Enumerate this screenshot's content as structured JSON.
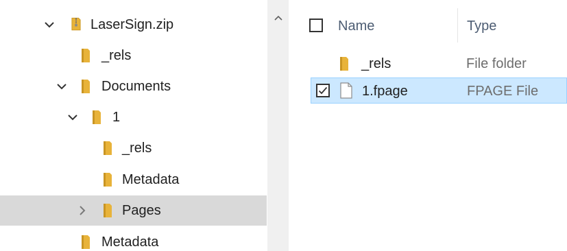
{
  "navigation": {
    "items": [
      {
        "label": "LaserSign.zip",
        "icon": "zip-folder-icon",
        "expanded": true
      },
      {
        "label": "_rels",
        "icon": "folder-icon"
      },
      {
        "label": "Documents",
        "icon": "folder-icon",
        "expanded": true
      },
      {
        "label": "1",
        "icon": "folder-icon",
        "expanded": true
      },
      {
        "label": "_rels",
        "icon": "folder-icon"
      },
      {
        "label": "Metadata",
        "icon": "folder-icon"
      },
      {
        "label": "Pages",
        "icon": "folder-icon",
        "expanded": false,
        "selected": true
      },
      {
        "label": "Metadata",
        "icon": "folder-icon"
      }
    ]
  },
  "scrollbar": {
    "up_arrow": "^"
  },
  "file_list": {
    "columns": {
      "name": "Name",
      "type": "Type"
    },
    "rows": [
      {
        "name": "_rels",
        "type": "File folder",
        "icon": "folder-icon",
        "selected": false
      },
      {
        "name": "1.fpage",
        "type": "FPAGE File",
        "icon": "document-icon",
        "selected": true,
        "checked": true
      }
    ]
  },
  "colors": {
    "folder": "#e8b33a",
    "folder_dark": "#c99523",
    "selection_nav": "#d9d9d9",
    "selection_list": "#cce8ff",
    "selection_border": "#99d1ff",
    "header_text": "#4d5d73"
  }
}
